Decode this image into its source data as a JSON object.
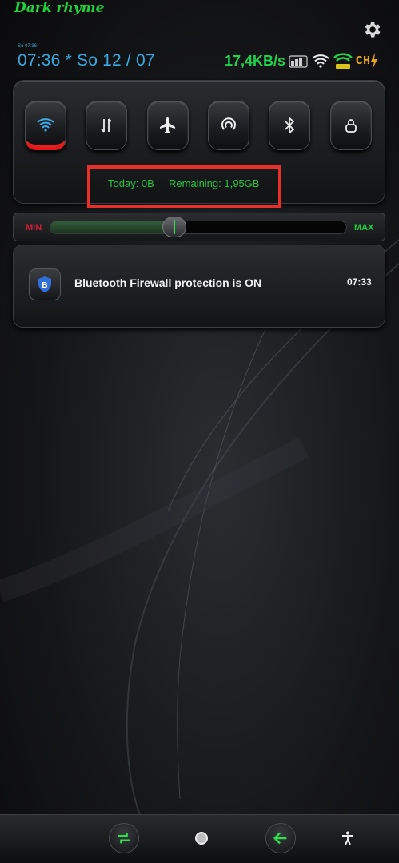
{
  "theme": {
    "title": "Dark rhyme"
  },
  "status_bar": {
    "small_clock": "So 07:36",
    "clock": "07:36 * So 12 / 07",
    "network_speed": "17,4KB/s",
    "icons": [
      "data-transfer-icon",
      "wifi-icon",
      "signal-bars-icon",
      "charging-battery-icon"
    ],
    "battery_text": "CH"
  },
  "quick_settings": {
    "toggles": [
      {
        "name": "wifi",
        "icon": "wifi-icon",
        "active": true
      },
      {
        "name": "mobile-data",
        "icon": "arrows-updown-icon",
        "active": false
      },
      {
        "name": "airplane-mode",
        "icon": "airplane-icon",
        "active": false
      },
      {
        "name": "hotspot",
        "icon": "hotspot-icon",
        "active": false
      },
      {
        "name": "bluetooth",
        "icon": "bluetooth-icon",
        "active": false
      },
      {
        "name": "lock",
        "icon": "lock-icon",
        "active": false
      }
    ],
    "data_usage": {
      "today": "Today: 0B",
      "remaining": "Remaining: 1,95GB"
    }
  },
  "brightness": {
    "min_label": "MIN",
    "max_label": "MAX",
    "level": 0.42
  },
  "notifications": [
    {
      "title": "Bluetooth Firewall protection is ON",
      "time": "07:33",
      "icon": "shield-b-icon",
      "icon_letter": "B"
    }
  ],
  "colors": {
    "accent_green": "#22d04c",
    "clock_blue": "#39a9e0",
    "alert_red": "#e8302b",
    "active_toggle_red": "#e11818"
  },
  "navigation": {
    "buttons": [
      "recents-button",
      "home-button",
      "back-button",
      "accessibility-button"
    ]
  }
}
